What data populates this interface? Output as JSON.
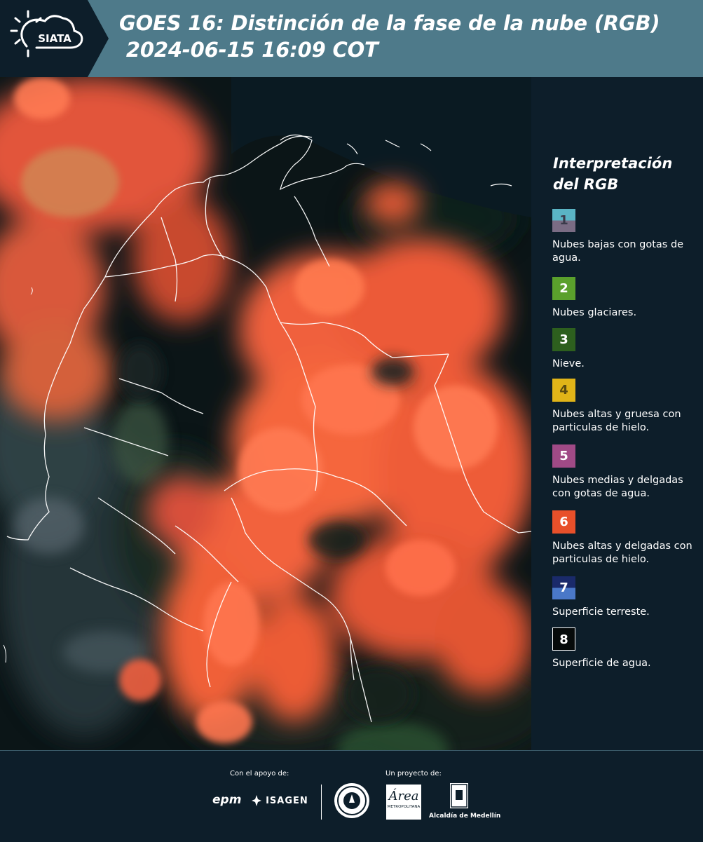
{
  "header": {
    "logo_text": "SIATA",
    "title": "GOES 16: Distinción de la fase de la nube (RGB)\n 2024-06-15 16:09 COT"
  },
  "legend": {
    "title": "Interpretación del RGB",
    "items": [
      {
        "number": "1",
        "label": "Nubes bajas con gotas de agua.",
        "color_top": "#5ab4c4",
        "color_bottom": "#7a6c84",
        "text_color": "#3a3a4a"
      },
      {
        "number": "2",
        "label": "Nubes glaciares.",
        "color_top": "#5aa02c",
        "color_bottom": "#5aa02c",
        "text_color": "#ffffff"
      },
      {
        "number": "3",
        "label": "Nieve.",
        "color_top": "#2d5f1e",
        "color_bottom": "#2d5f1e",
        "text_color": "#ffffff"
      },
      {
        "number": "4",
        "label": "Nubes altas y gruesa con particulas de hielo.",
        "color_top": "#e0b418",
        "color_bottom": "#e0b418",
        "text_color": "#5a4a10"
      },
      {
        "number": "5",
        "label": "Nubes medias y delgadas con gotas de agua.",
        "color_top": "#a04a86",
        "color_bottom": "#a04a86",
        "text_color": "#ffffff"
      },
      {
        "number": "6",
        "label": "Nubes altas y delgadas con particulas de hielo.",
        "color_top": "#e8502a",
        "color_bottom": "#e8502a",
        "text_color": "#ffffff"
      },
      {
        "number": "7",
        "label": "Superficie terreste.",
        "color_top": "#1a2a6a",
        "color_bottom": "#4a78c8",
        "text_color": "#ffffff"
      },
      {
        "number": "8",
        "label": "Superficie de agua.",
        "color_top": "#060a0a",
        "color_bottom": "#060a0a",
        "text_color": "#ffffff"
      }
    ]
  },
  "footer": {
    "support_label": "Con el apoyo de:",
    "project_label": "Un proyecto de:",
    "sponsor_1": "epm",
    "sponsor_2": "ISAGEN",
    "partner_1": "Área",
    "partner_1_sub": "METROPOLITANA",
    "partner_2": "Alcaldía de Medellín"
  }
}
